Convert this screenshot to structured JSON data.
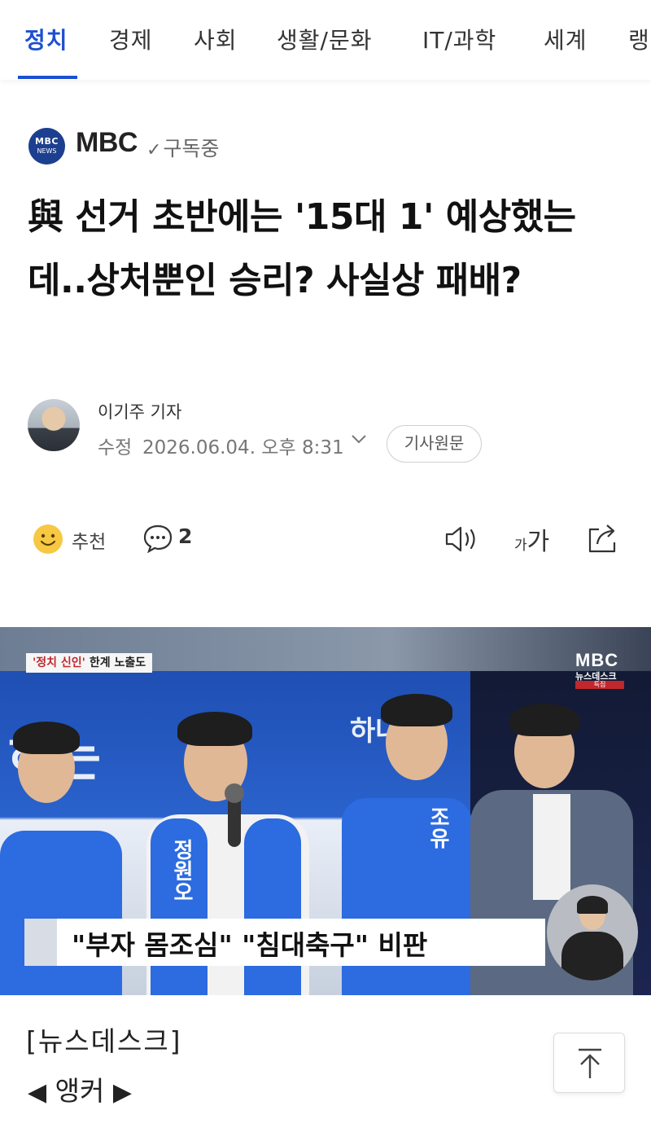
{
  "nav": {
    "tabs": [
      {
        "label": "정치",
        "active": true
      },
      {
        "label": "경제",
        "active": false
      },
      {
        "label": "사회",
        "active": false
      },
      {
        "label": "생활/문화",
        "active": false
      },
      {
        "label": "IT/과학",
        "active": false
      },
      {
        "label": "세계",
        "active": false
      },
      {
        "label": "랭",
        "active": false
      }
    ],
    "accent_color": "#1c4fd1"
  },
  "press": {
    "logo_text_top": "MBC",
    "logo_text_bottom": "NEWS",
    "name": "MBC",
    "subscribe_check": "✓",
    "subscribe_label": "구독중"
  },
  "article": {
    "headline": "與 선거 초반에는 '15대 1' 예상했는데..상처뿐인 승리? 사실상 패배?",
    "reporter": "이기주 기자",
    "modified_label": "수정",
    "modified_time": "2026.06.04. 오후 8:31",
    "original_button": "기사원문"
  },
  "actions": {
    "recommend_label": "추천",
    "comment_count": "2",
    "font_small": "가",
    "font_big": "가"
  },
  "video": {
    "tag_quote": "'정치 신인'",
    "tag_rest": " 한계 노출도",
    "broadcaster_logo": "MBC",
    "program_badge": "뉴스데스크",
    "program_badge_sub": "특집",
    "bg_slogan": "하는",
    "bg_slogan2": "하나",
    "caption": "\"부자 몸조심\" \"침대축구\" 비판",
    "vest_name_left": "정원오",
    "vest_name_right": "조유"
  },
  "body": {
    "program": "[뉴스데스크]",
    "anchor_left": "◀",
    "anchor_label": "앵커",
    "anchor_right": "▶"
  }
}
